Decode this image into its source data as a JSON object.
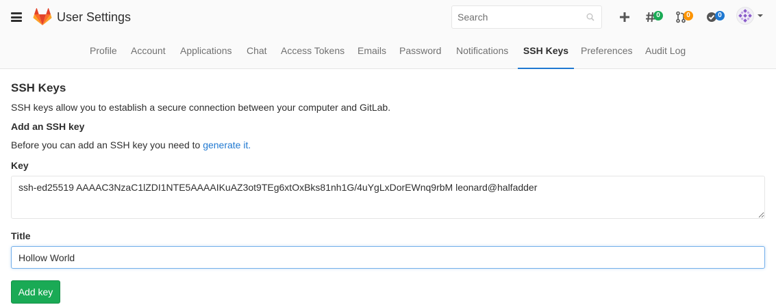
{
  "header": {
    "title": "User Settings",
    "search_placeholder": "Search",
    "badges": {
      "issues": "0",
      "merge_requests": "0",
      "todos": "0"
    },
    "colors": {
      "issues_badge": "#1aaa55",
      "mr_badge": "#fc9403",
      "todos_badge": "#1f78d1",
      "accent": "#1f78d1"
    }
  },
  "tabs": [
    {
      "label": "Profile"
    },
    {
      "label": "Account"
    },
    {
      "label": "Applications"
    },
    {
      "label": "Chat"
    },
    {
      "label": "Access Tokens"
    },
    {
      "label": "Emails"
    },
    {
      "label": "Password"
    },
    {
      "label": "Notifications"
    },
    {
      "label": "SSH Keys",
      "active": true
    },
    {
      "label": "Preferences"
    },
    {
      "label": "Audit Log"
    }
  ],
  "page": {
    "heading": "SSH Keys",
    "description": "SSH keys allow you to establish a secure connection between your computer and GitLab.",
    "add_heading": "Add an SSH key",
    "before_text": "Before you can add an SSH key you need to ",
    "generate_link": "generate it.",
    "key_label": "Key",
    "key_value": "ssh-ed25519 AAAAC3NzaC1lZDI1NTE5AAAAIKuAZ3ot9TEg6xtOxBks81nh1G/4uYgLxDorEWnq9rbM leonard@halfadder",
    "title_label": "Title",
    "title_value": "Hollow World",
    "submit_label": "Add key"
  }
}
